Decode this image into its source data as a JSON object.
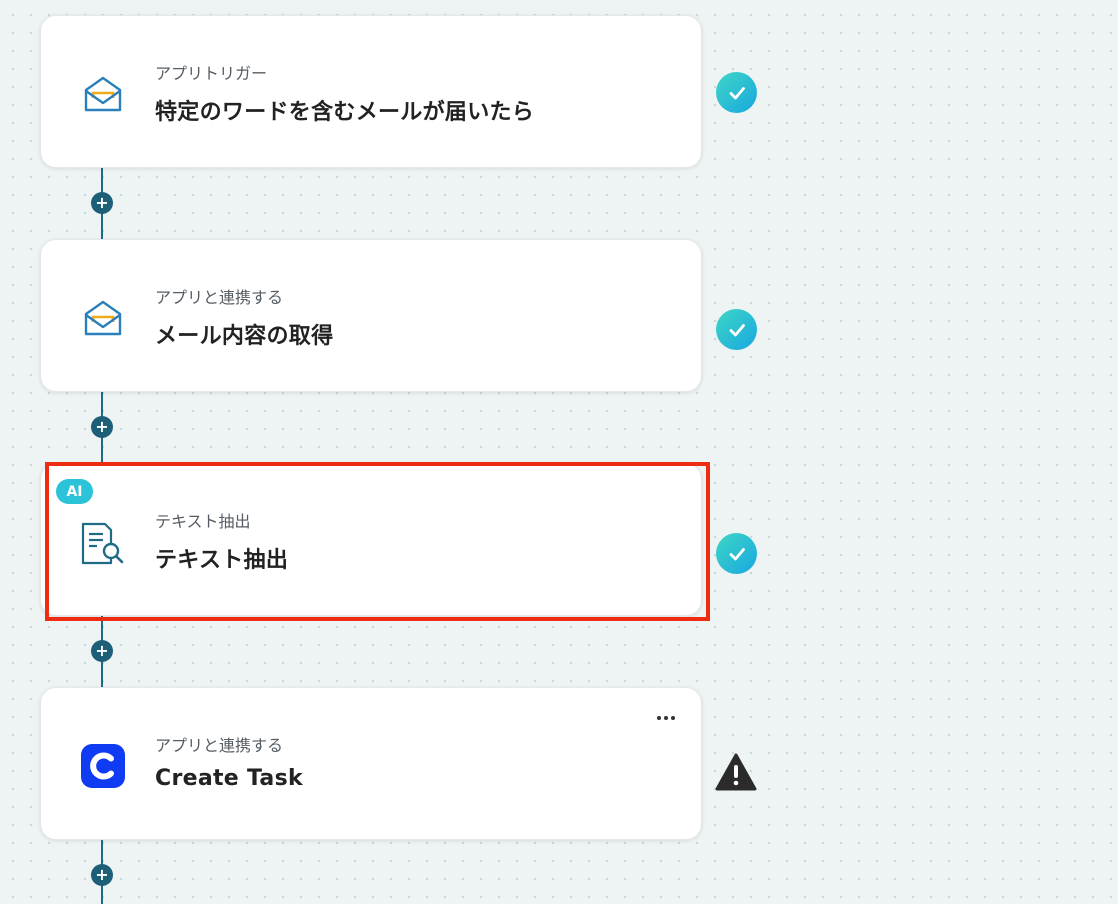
{
  "flow": {
    "steps": [
      {
        "type_label": "アプリトリガー",
        "title": "特定のワードを含むメールが届いたら",
        "icon": "mail-open-icon",
        "status": "completed"
      },
      {
        "type_label": "アプリと連携する",
        "title": "メール内容の取得",
        "icon": "mail-open-icon",
        "status": "completed"
      },
      {
        "type_label": "テキスト抽出",
        "title": "テキスト抽出",
        "icon": "document-search-icon",
        "status": "completed",
        "badge": "AI",
        "highlighted": true
      },
      {
        "type_label": "アプリと連携する",
        "title": "Create Task",
        "icon": "clickup-c-icon",
        "status": "warning"
      }
    ],
    "add_step_symbol": "+",
    "more_menu_icon": "ellipsis-icon"
  },
  "colors": {
    "connector": "#1f6b85",
    "check_gradient_start": "#3fd7c5",
    "check_gradient_end": "#18a7e0",
    "highlight": "#ee2c12",
    "ai_badge": "#2bc3d8",
    "app_icon_blue": "#0f3bf2"
  }
}
